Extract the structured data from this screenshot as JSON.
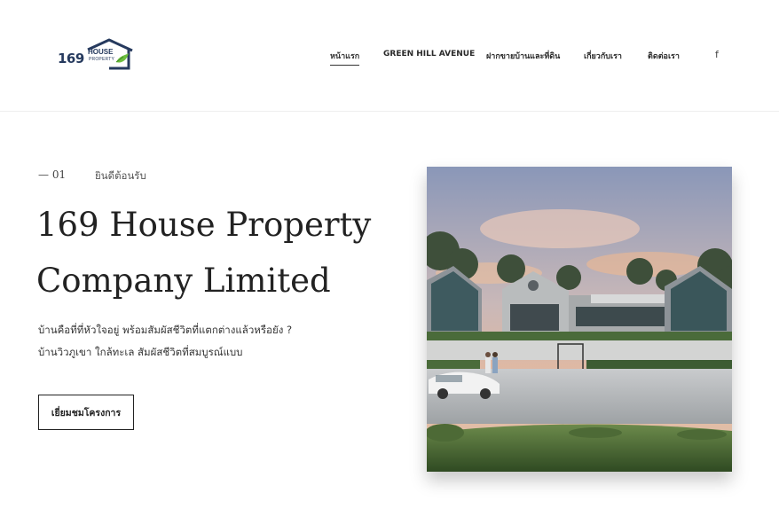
{
  "brand": {
    "number": "169",
    "word1": "HOUSE",
    "word2": "PROPERTY",
    "navy": "#263a5e",
    "leaf_green": "#6dbf3f"
  },
  "nav": {
    "items": [
      {
        "label": "หน้าแรก",
        "active": true
      },
      {
        "label": "GREEN HILL AVENUE",
        "active": false
      },
      {
        "label": "ฝากขายบ้านและที่ดิน",
        "active": false
      },
      {
        "label": "เกี่ยวกับเรา",
        "active": false
      },
      {
        "label": "ติดต่อเรา",
        "active": false
      }
    ],
    "social_icon": "facebook-icon"
  },
  "hero": {
    "eyebrow_num": "— 01",
    "eyebrow_text": "ยินดีต้อนรับ",
    "title_line1": "169 House Property",
    "title_line2": "Company Limited",
    "desc_line1": "บ้านคือที่ที่หัวใจอยู่ พร้อมสัมผัสชีวิตที่แตกต่างแล้วหรือยัง ?",
    "desc_line2": "บ้านวิวภูเขา ใกล้ทะเล สัมผัสชีวิตที่สมบูรณ์แบบ",
    "cta_label": "เยี่ยมชมโครงการ"
  }
}
